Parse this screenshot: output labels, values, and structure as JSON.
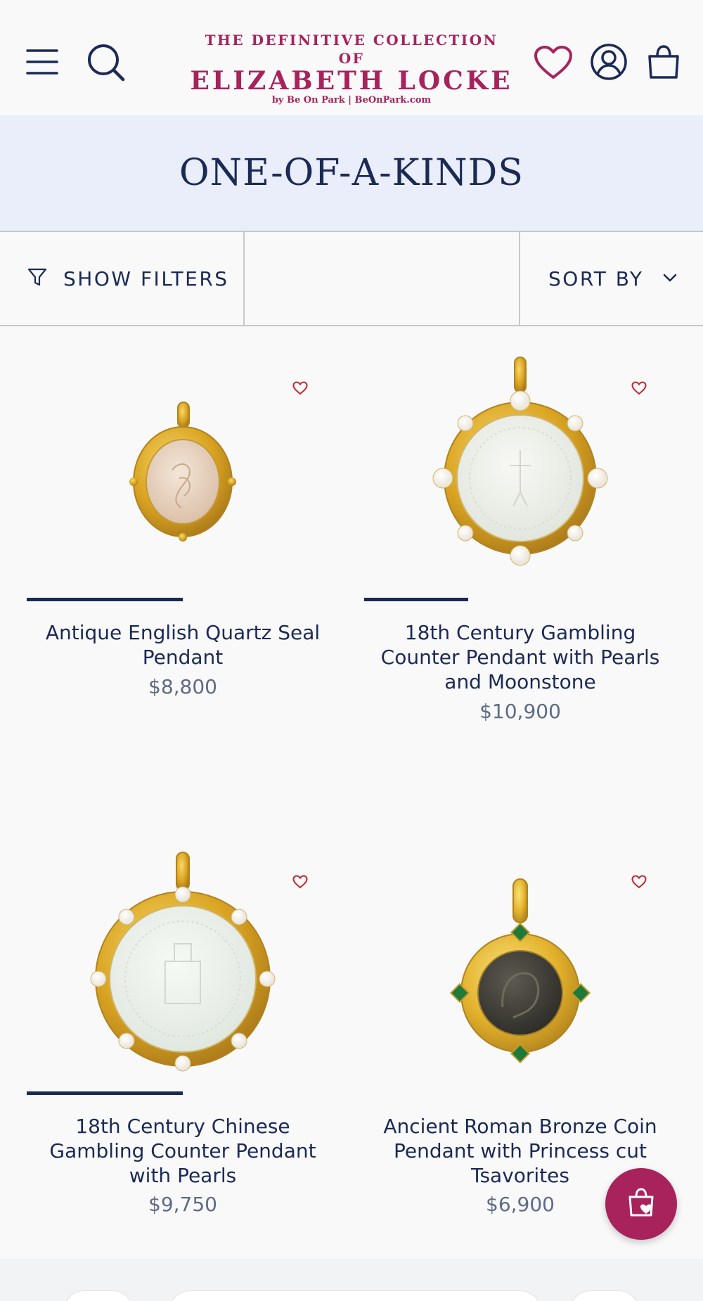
{
  "header": {
    "logo": {
      "top": "THE DEFINITIVE COLLECTION OF",
      "main": "ELIZABETH LOCKE",
      "sub": "by Be On Park | BeOnPark.com"
    },
    "icons": [
      "menu-icon",
      "search-icon",
      "heart-icon",
      "account-icon",
      "bag-icon"
    ]
  },
  "page": {
    "title": "ONE-OF-A-KINDS"
  },
  "toolbar": {
    "filters_label": "SHOW FILTERS",
    "sort_label": "SORT BY"
  },
  "products": [
    {
      "name": "Antique English Quartz Seal Pendant",
      "price": "$8,800"
    },
    {
      "name": "18th Century Gambling Counter Pendant with Pearls and Moonstone",
      "price": "$10,900"
    },
    {
      "name": "18th Century Chinese Gambling Counter Pendant with Pearls",
      "price": "$9,750"
    },
    {
      "name": "Ancient Roman Bronze Coin Pendant with Princess cut Tsavorites",
      "price": "$6,900"
    }
  ],
  "colors": {
    "brand": "#a8225c",
    "navy": "#1b2a55",
    "title_band": "#e9eefa",
    "price": "#5e6b86",
    "wishlist": "#c0272d"
  }
}
